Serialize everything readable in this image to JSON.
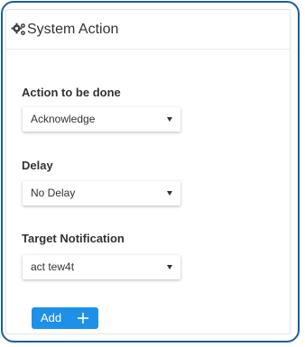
{
  "panel": {
    "title": "System Action",
    "header_icon": "gears-icon"
  },
  "fields": {
    "action": {
      "label": "Action to be done",
      "selected": "Acknowledge"
    },
    "delay": {
      "label": "Delay",
      "selected": "No Delay"
    },
    "target": {
      "label": "Target Notification",
      "selected": "act tew4t"
    }
  },
  "add_button": {
    "label": "Add",
    "icon": "plus-icon"
  },
  "colors": {
    "frame_border": "#1a5fa0",
    "button_bg": "#1e90e8",
    "text": "#333333"
  }
}
